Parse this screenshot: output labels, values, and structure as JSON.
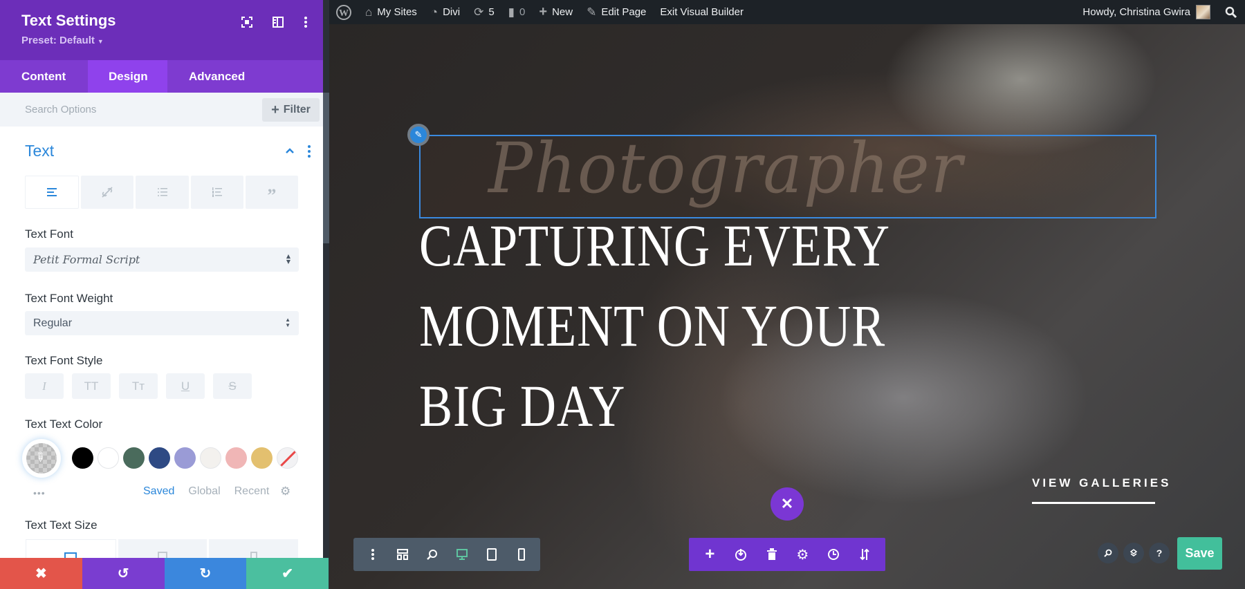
{
  "sidebar": {
    "title": "Text Settings",
    "preset": "Preset: Default",
    "header_icons": [
      "focus-mode-icon",
      "split-view-icon",
      "more-options-icon"
    ],
    "tabs": [
      {
        "label": "Content",
        "active": false
      },
      {
        "label": "Design",
        "active": true
      },
      {
        "label": "Advanced",
        "active": false
      }
    ],
    "search": {
      "placeholder": "Search Options",
      "value": ""
    },
    "filter_label": "Filter",
    "group": {
      "title": "Text",
      "subtabs": [
        "align-left-icon",
        "link-icon",
        "unordered-list-icon",
        "ordered-list-icon",
        "quote-icon"
      ],
      "active_subtab": 0
    },
    "fields": {
      "font": {
        "label": "Text Font",
        "value": "Petit Formal Script"
      },
      "weight": {
        "label": "Text Font Weight",
        "value": "Regular"
      },
      "style": {
        "label": "Text Font Style",
        "buttons": [
          "I",
          "TT",
          "Tт",
          "U",
          "S"
        ]
      },
      "color": {
        "label": "Text Text Color",
        "swatches": [
          "#000000",
          "#ffffff",
          "#4a6b5c",
          "#2e4a84",
          "#9a9bd6",
          "#f3f1ee",
          "#f0b6b6",
          "#e3c06f",
          "none"
        ],
        "palette_tabs": [
          "Saved",
          "Global",
          "Recent"
        ],
        "active_palette": "Saved",
        "more": "•••"
      },
      "size": {
        "label": "Text Text Size",
        "devices": [
          "desktop",
          "tablet",
          "phone"
        ],
        "active_device": "desktop"
      }
    },
    "footer": [
      {
        "name": "discard",
        "icon": "✖",
        "color": "#e3554a"
      },
      {
        "name": "undo",
        "icon": "↺",
        "color": "#7a3dd0"
      },
      {
        "name": "redo",
        "icon": "↻",
        "color": "#3b87dd"
      },
      {
        "name": "save",
        "icon": "✔",
        "color": "#4bbf9f"
      }
    ]
  },
  "adminbar": {
    "items": [
      {
        "icon": "wordpress-icon",
        "label": ""
      },
      {
        "icon": "my-sites-icon",
        "label": "My Sites"
      },
      {
        "icon": "dashboard-icon",
        "label": "Divi"
      },
      {
        "icon": "updates-icon",
        "label": "5"
      },
      {
        "icon": "comments-icon",
        "label": "0"
      },
      {
        "icon": "plus-icon",
        "label": "New"
      },
      {
        "icon": "pencil-icon",
        "label": "Edit Page"
      },
      {
        "icon": "",
        "label": "Exit Visual Builder"
      }
    ],
    "greeting": "Howdy, Christina Gwira"
  },
  "canvas": {
    "script_text": "Photographer",
    "headline_lines": [
      "CAPTURING EVERY",
      "MOMENT ON YOUR",
      "BIG DAY"
    ],
    "cta": "VIEW GALLERIES",
    "save_label": "Save",
    "help_label": "?"
  },
  "colors": {
    "purple": "#6c2eb9",
    "accent_blue": "#2b87da",
    "save_green": "#42bf9b"
  }
}
